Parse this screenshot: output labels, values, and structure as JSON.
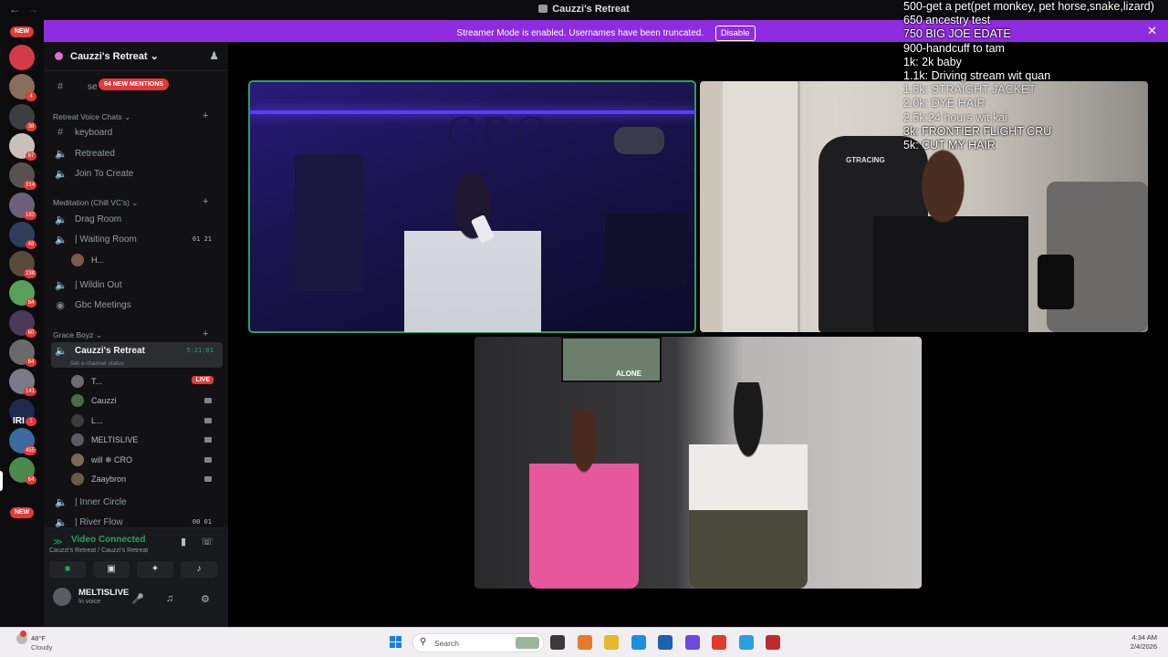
{
  "window": {
    "title": "Cauzzi's Retreat"
  },
  "banner": {
    "message": "Streamer Mode is enabled. Usernames have been truncated.",
    "disable_label": "Disable"
  },
  "rail": {
    "top_badge": "NEW",
    "bottom_badge": "NEW",
    "servers": [
      {
        "color": "#d43b4a",
        "count": ""
      },
      {
        "color": "#8a6d5a",
        "count": "4"
      },
      {
        "color": "#3d3d44",
        "count": "38"
      },
      {
        "color": "#c9c1b9",
        "count": "87"
      },
      {
        "color": "#595050",
        "count": "314"
      },
      {
        "color": "#6d5e7a",
        "count": "182"
      },
      {
        "color": "#2e3e5a",
        "count": "48"
      },
      {
        "color": "#5a4a3a",
        "count": "238"
      },
      {
        "color": "#5aa05a",
        "count": "64"
      },
      {
        "color": "#4a3a5a",
        "count": "60"
      },
      {
        "color": "#6a6a6a",
        "count": "64"
      },
      {
        "color": "#7a7a8a",
        "count": "141"
      },
      {
        "color": "#1d2a4a",
        "count": "1"
      },
      {
        "color": "#3a6aa0",
        "count": "455"
      },
      {
        "color": "#4a8a4a",
        "count": "64"
      }
    ],
    "rail_text": "IRI"
  },
  "sidebar": {
    "guild_name": "Cauzzi's Retreat",
    "mentions_label": "64 NEW MENTIONS",
    "top_channel": "se",
    "categories": {
      "retreat_voice": "Retreat Voice Chats",
      "meditation": "Meditation (Chill VC's)",
      "grace_boyz": "Grace Boyz"
    },
    "channels": {
      "keyboard": "keyboard",
      "retreated": "Retreated",
      "join_to_create": "Join To Create",
      "drag_room": "Drag Room",
      "waiting_room": "| Waiting Room",
      "waiting_room_counts": "01  21",
      "waiting_member": "H...",
      "wildin_out": "| Wildin Out",
      "gbc_meetings": "Gbc Meetings",
      "cauzzis_retreat": "Cauzzi's Retreat",
      "cauzzis_timer": "5:21:01",
      "channel_status": "Set a channel status",
      "inner_circle": "| Inner Circle",
      "river_flow": "| River Flow",
      "river_flow_counts": "00  01"
    },
    "voice_members": [
      {
        "name": "T...",
        "live": "LIVE",
        "color": "#6c6c6c"
      },
      {
        "name": "Cauzzi",
        "live": "",
        "color": "#4a6a4a"
      },
      {
        "name": "L...",
        "live": "",
        "color": "#3a3a3a"
      },
      {
        "name": "MELTISLIVE",
        "live": "",
        "color": "#5a5c62"
      },
      {
        "name": "will ❄ CRO",
        "live": "",
        "color": "#7a6a5a"
      },
      {
        "name": "Zaaybron",
        "live": "",
        "color": "#6a5a4a"
      }
    ]
  },
  "voice_panel": {
    "status": "Video Connected",
    "location": "Cauzzi's Retreat / Cauzzi's Retreat"
  },
  "user_panel": {
    "username": "MELTISLIVE",
    "status": "In voice"
  },
  "video": {
    "tile1_wall_text": "GBC",
    "tile2_chair_brand": "GTRACING",
    "tile3_tv_text": "ALONE"
  },
  "overlay": {
    "lines": [
      "500-get a pet(pet monkey, pet horse,snake,lizard)",
      "650 ancestry test",
      "750 BIG JOE EDATE",
      "900-handcuff to tam",
      "1k: 2k baby",
      "1.1k: Driving stream wit quan",
      "1.5k: STRAIGHT JACKET",
      "2.0k: DYE HAIR",
      "2.5k:24 hours wit kai",
      "3k: FRONTIER FLIGHT CRU",
      "5k: CUT MY HAIR"
    ]
  },
  "taskbar": {
    "temperature": "48°F",
    "condition": "Cloudy",
    "search_placeholder": "Search",
    "time": "4:34 AM",
    "date": "2/4/2026",
    "apps": [
      "#3a3a3a",
      "#e67a2a",
      "#e6b82a",
      "#1e8fe0",
      "#1e5fb0",
      "#6a4ae0",
      "#e03a2a",
      "#2a9fe0",
      "#c02a2a"
    ]
  }
}
